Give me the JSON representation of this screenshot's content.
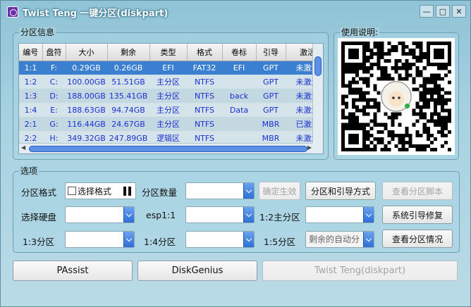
{
  "window": {
    "title": "Twist Teng 一键分区(diskpart)",
    "controls": {
      "minimize": "—",
      "maximize": "□",
      "close": "✕"
    }
  },
  "partition_group": {
    "label": "分区信息",
    "columns": [
      "编号",
      "盘符",
      "大小",
      "剩余",
      "类型",
      "格式",
      "卷标",
      "引导",
      "激活"
    ],
    "rows": [
      [
        "1:1",
        "F:",
        "0.29GB",
        "0.26GB",
        "EFI",
        "FAT32",
        "EFI",
        "GPT",
        "未激活"
      ],
      [
        "1:2",
        "C:",
        "100.00GB",
        "51.51GB",
        "主分区",
        "NTFS",
        "",
        "GPT",
        "未激活"
      ],
      [
        "1:3",
        "D:",
        "188.00GB",
        "135.41GB",
        "主分区",
        "NTFS",
        "back",
        "GPT",
        "未激活"
      ],
      [
        "1:4",
        "E:",
        "188.63GB",
        "94.74GB",
        "主分区",
        "NTFS",
        "Data",
        "GPT",
        "未激活"
      ],
      [
        "2:1",
        "G:",
        "116.44GB",
        "24.67GB",
        "主分区",
        "NTFS",
        "",
        "MBR",
        "已激活"
      ],
      [
        "2:2",
        "H:",
        "349.32GB",
        "247.89GB",
        "逻辑区",
        "NTFS",
        "",
        "MBR",
        "未激活"
      ]
    ]
  },
  "usage_group": {
    "label": "使用说明:"
  },
  "options_group": {
    "label": "选项",
    "partition_format_label": "分区格式",
    "select_format_checkbox": "选择格式",
    "partition_count_label": "分区数量",
    "partition_count_value": "",
    "confirm_button": "确定生效",
    "partition_boot_button": "分区和引导方式",
    "view_script_button": "查看分区脚本",
    "select_disk_label": "选择硬盘",
    "select_disk_value": "",
    "esp_label": "esp1:1",
    "esp_value": "",
    "primary2_label": "1:2主分区",
    "primary2_value": "",
    "boot_repair_button": "系统引导修复",
    "part3_label": "1:3分区",
    "part3_value": "",
    "part4_label": "1:4分区",
    "part4_value": "",
    "part5_label": "1:5分区",
    "part5_value": "剩余的自动分",
    "view_partitions_button": "查看分区情况"
  },
  "bottom_buttons": {
    "passist": "PAssist",
    "diskgenius": "DiskGenius",
    "twistteng": "Twist Teng(diskpart)"
  },
  "colors": {
    "accent": "#3b7fd0",
    "table_text": "#1d2fd1",
    "scroll_thumb": "#5c8fe8"
  }
}
